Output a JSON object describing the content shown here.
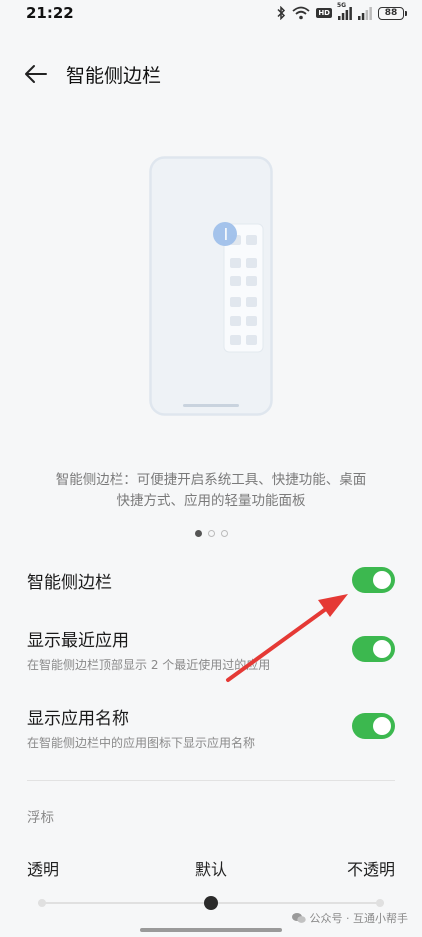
{
  "status_bar": {
    "time": "21:22",
    "hd_label": "HD",
    "network_label": "5G",
    "battery": "88"
  },
  "header": {
    "title": "智能侧边栏"
  },
  "intro": {
    "description_line1": "智能侧边栏：可便捷开启系统工具、快捷功能、桌面",
    "description_line2": "快捷方式、应用的轻量功能面板",
    "page_count": 3,
    "active_page": 1
  },
  "settings": [
    {
      "title": "智能侧边栏",
      "subtitle": "",
      "enabled": true
    },
    {
      "title": "显示最近应用",
      "subtitle": "在智能侧边栏顶部显示 2 个最近使用过的应用",
      "enabled": true
    },
    {
      "title": "显示应用名称",
      "subtitle": "在智能侧边栏中的应用图标下显示应用名称",
      "enabled": true
    }
  ],
  "float_section": {
    "label": "浮标",
    "left_label": "透明",
    "mid_label": "默认",
    "right_label": "不透明",
    "slider_value": 0.5
  },
  "watermark": "公众号 · 互通小帮手",
  "colors": {
    "toggle_on": "#3cb84f",
    "annotation_arrow": "#e53935"
  }
}
